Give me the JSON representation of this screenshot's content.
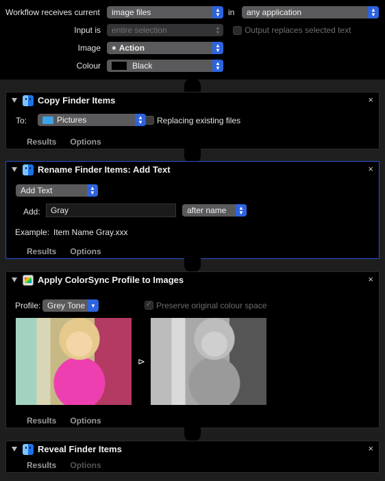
{
  "workflow_header": {
    "receives_label": "Workflow receives current",
    "receives_value": "image files",
    "in_label": "in",
    "app_value": "any application",
    "input_is_label": "Input is",
    "input_is_value": "entire selection",
    "output_replaces_label": "Output replaces selected text",
    "image_label": "Image",
    "image_value": "Action",
    "colour_label": "Colour",
    "colour_value": "Black"
  },
  "actions": [
    {
      "title": "Copy Finder Items",
      "to_label": "To:",
      "to_value": "Pictures",
      "replacing_label": "Replacing existing files",
      "results_label": "Results",
      "options_label": "Options"
    },
    {
      "title": "Rename Finder Items: Add Text",
      "mode_value": "Add Text",
      "add_label": "Add:",
      "add_value": "Gray",
      "position_value": "after name",
      "example_label": "Example:",
      "example_value": "Item Name Gray.xxx",
      "results_label": "Results",
      "options_label": "Options"
    },
    {
      "title": "Apply ColorSync Profile to Images",
      "profile_label": "Profile:",
      "profile_value": "Grey Tone",
      "preserve_label": "Preserve original colour space",
      "arrow_glyph": "⊳",
      "results_label": "Results",
      "options_label": "Options"
    },
    {
      "title": "Reveal Finder Items",
      "results_label": "Results",
      "options_label": "Options"
    }
  ],
  "glyphs": {
    "close": "×",
    "gear": "✱"
  },
  "colors": {
    "accent": "#2d63de",
    "selected_border": "#2855d6"
  }
}
